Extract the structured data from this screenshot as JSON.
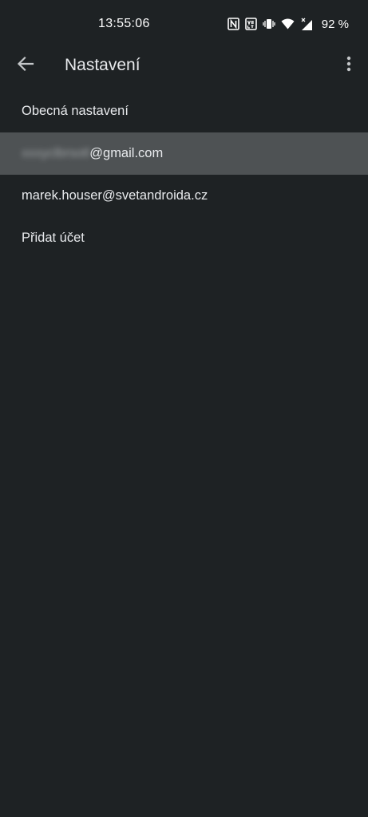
{
  "status_bar": {
    "time": "13:55:06",
    "icons": [
      "nfc-icon",
      "volte-icon",
      "vibrate-icon",
      "wifi-icon",
      "cell-signal-icon",
      "battery-icon"
    ],
    "battery_text": "92 %"
  },
  "app_bar": {
    "back_icon": "arrow-back-icon",
    "title": "Nastavení",
    "more_icon": "more-vert-icon"
  },
  "settings": {
    "items": [
      {
        "label": "Obecná nastavení"
      },
      {
        "label_prefix": "xxxyclbrsotl",
        "label": "@gmail.com",
        "selected": true
      },
      {
        "label": "marek.houser@svetandroida.cz"
      },
      {
        "label": "Přidat účet"
      }
    ]
  },
  "colors": {
    "background": "#1e2224",
    "selected_row": "#4e5254",
    "text_primary": "#e8eaed"
  }
}
